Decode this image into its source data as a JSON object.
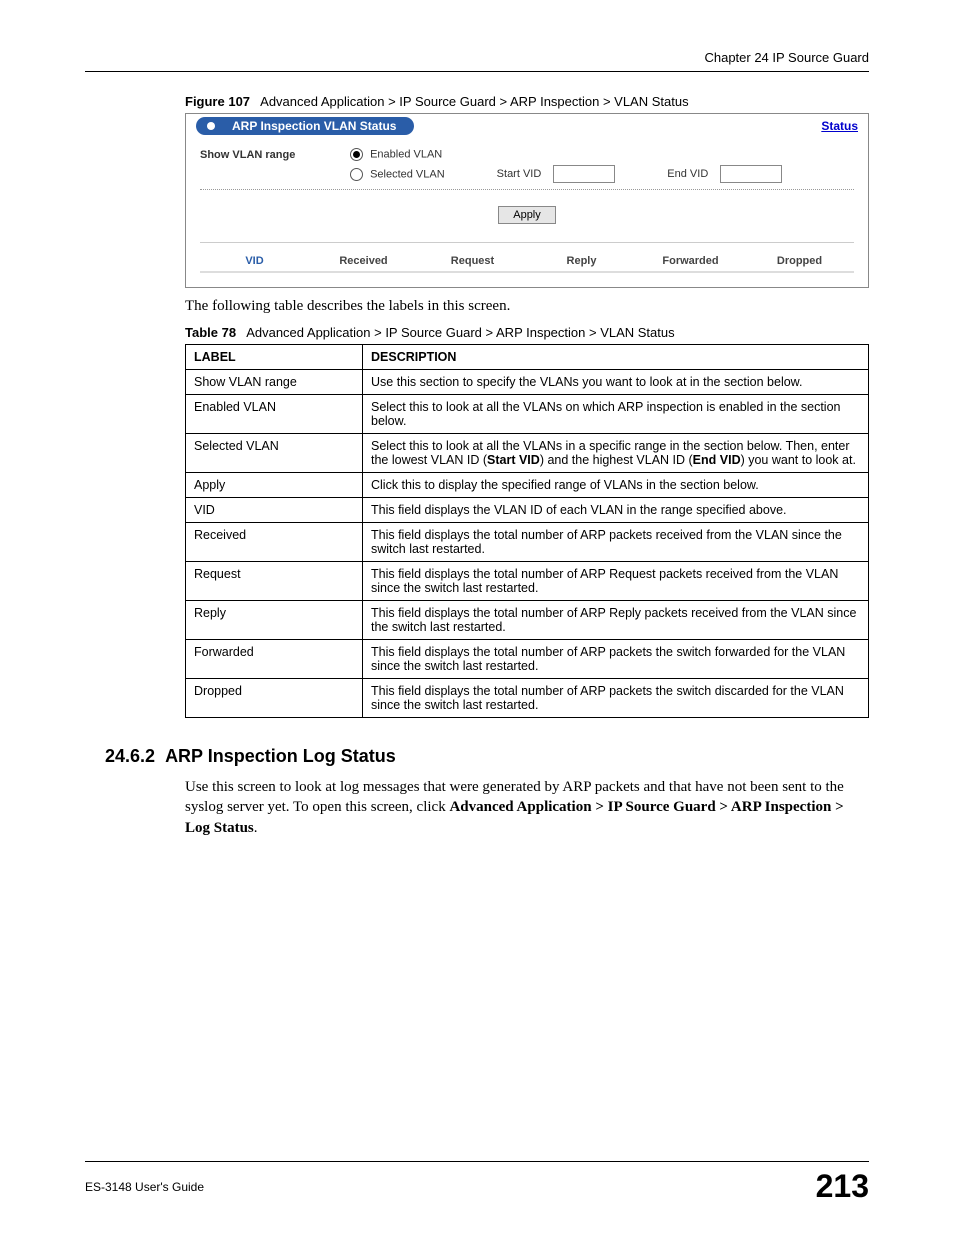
{
  "header": {
    "right": "Chapter 24 IP Source Guard"
  },
  "figure": {
    "label": "Figure 107",
    "caption": "Advanced Application > IP Source Guard > ARP Inspection > VLAN Status"
  },
  "ui": {
    "title": "ARP Inspection VLAN Status",
    "status_link": "Status",
    "row_label": "Show VLAN range",
    "radio1": "Enabled VLAN",
    "radio2": "Selected VLAN",
    "start_vid": "Start VID",
    "end_vid": "End VID",
    "apply": "Apply",
    "cols": {
      "c1": "VID",
      "c2": "Received",
      "c3": "Request",
      "c4": "Reply",
      "c5": "Forwarded",
      "c6": "Dropped"
    }
  },
  "intro_text": "The following table describes the labels in this screen.",
  "table": {
    "label": "Table 78",
    "caption": "Advanced Application > IP Source Guard > ARP Inspection > VLAN Status",
    "head": {
      "c1": "LABEL",
      "c2": "DESCRIPTION"
    },
    "rows": [
      {
        "label": "Show VLAN range",
        "desc": "Use this section to specify the VLANs you want to look at in the section below."
      },
      {
        "label": "Enabled VLAN",
        "desc": "Select this to look at all the VLANs on which ARP inspection is enabled in the section below."
      },
      {
        "label": "Selected VLAN",
        "desc_pre": "Select this to look at all the VLANs in a specific range in the section below. Then, enter the lowest VLAN ID (",
        "bold1": "Start VID",
        "desc_mid": ") and the highest VLAN ID (",
        "bold2": "End VID",
        "desc_post": ") you want to look at."
      },
      {
        "label": "Apply",
        "desc": "Click this to display the specified range of VLANs in the section below."
      },
      {
        "label": "VID",
        "desc": "This field displays the VLAN ID of each VLAN in the range specified above."
      },
      {
        "label": "Received",
        "desc": "This field displays the total number of ARP packets received from the VLAN since the switch last restarted."
      },
      {
        "label": "Request",
        "desc": "This field displays the total number of ARP Request packets received from the VLAN since the switch last restarted."
      },
      {
        "label": "Reply",
        "desc": "This field displays the total number of ARP Reply packets received from the VLAN since the switch last restarted."
      },
      {
        "label": "Forwarded",
        "desc": "This field displays the total number of ARP packets the switch forwarded for the VLAN since the switch last restarted."
      },
      {
        "label": "Dropped",
        "desc": "This field displays the total number of ARP packets the switch discarded for the VLAN since the switch last restarted."
      }
    ]
  },
  "section": {
    "number": "24.6.2",
    "title": "ARP Inspection Log Status",
    "p1a": "Use this screen to look at log messages that were generated by ARP packets and that have not been sent to the syslog server yet. To open this screen, click ",
    "p1b": "Advanced Application > IP Source Guard > ARP Inspection > Log Status",
    "p1c": "."
  },
  "footer": {
    "left": "ES-3148 User's Guide",
    "page": "213"
  }
}
